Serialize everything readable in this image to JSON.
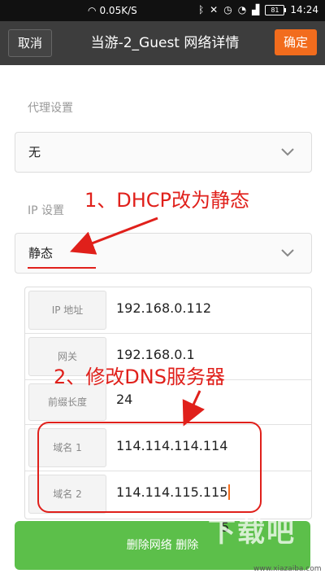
{
  "statusbar": {
    "net_speed": "0.05K/S",
    "battery_level": "81",
    "time": "14:24"
  },
  "header": {
    "cancel_label": "取消",
    "title": "当游-2_Guest 网络详情",
    "confirm_label": "确定"
  },
  "proxy": {
    "label": "代理设置",
    "value": "无"
  },
  "ip_settings": {
    "label": "IP 设置",
    "value": "静态"
  },
  "fields": [
    {
      "label": "IP 地址",
      "value": "192.168.0.112"
    },
    {
      "label": "网关",
      "value": "192.168.0.1"
    },
    {
      "label": "前缀长度",
      "value": "24"
    },
    {
      "label": "域名 1",
      "value": "114.114.114.114"
    },
    {
      "label": "域名 2",
      "value": "114.114.115.115"
    }
  ],
  "delete_button_label": "删除网络 删除",
  "partial_digit": "5",
  "annotations": {
    "step1": "1、DHCP改为静态",
    "step2": "2、修改DNS服务器"
  },
  "watermark": {
    "brand": "下载吧",
    "url": "www.xiazaiba.com"
  },
  "colors": {
    "accent_orange": "#f26c1d",
    "title_bar": "#3d3d3d",
    "delete_green": "#5cbf4a",
    "annotation_red": "#e0201b"
  }
}
